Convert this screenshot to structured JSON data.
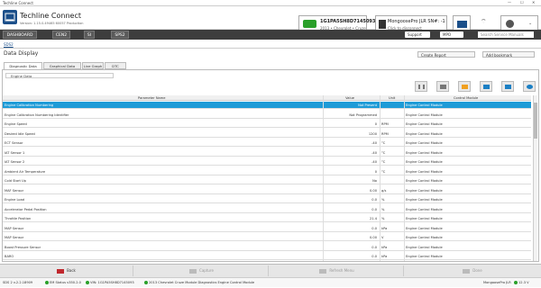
{
  "window": {
    "title": "Techline Connect",
    "controls": [
      "—",
      "☐",
      "✕"
    ]
  },
  "header": {
    "app_title": "Techline Connect",
    "version": "Version: 1.15.0.49465 60057 Production",
    "vin": "1G1PA5SH8D7145093",
    "vehicle": "2013 • Chevrolet • Cruze",
    "device": "MongoosePro JLR SN#: -1",
    "device_status": "Click to disconnect",
    "chevron": "⌄"
  },
  "nav": {
    "items": [
      "DASHBOARD",
      "CEN2",
      "SI",
      "SPS2"
    ],
    "support": "Support",
    "mpo": "MPO",
    "search_placeholder": "Search Service Manuals"
  },
  "breadcrumb": "SDS2",
  "page": {
    "title": "Data Display",
    "create_report": "Create Report",
    "add_bookmark": "Add bookmark"
  },
  "tabs": [
    "Diagnostic Data Display",
    "Graphical Data Display",
    "Live Graph",
    "DTC Display"
  ],
  "engine_data": "Engine Data",
  "grid": {
    "headers": [
      "Parameter Name",
      "Value",
      "Unit",
      "Control Module"
    ],
    "rows": [
      [
        "Engine Calibration Numbering",
        "Not Present",
        "",
        "Engine Control Module"
      ],
      [
        "Engine Calibration Numbering Identifier",
        "Not Programmed",
        "",
        "Engine Control Module"
      ],
      [
        "Engine Speed",
        "0",
        "RPM",
        "Engine Control Module"
      ],
      [
        "Desired Idle Speed",
        "1200",
        "RPM",
        "Engine Control Module"
      ],
      [
        "ECT Sensor",
        "-40",
        "°C",
        "Engine Control Module"
      ],
      [
        "IAT Sensor 1",
        "-40",
        "°C",
        "Engine Control Module"
      ],
      [
        "IAT Sensor 2",
        "-40",
        "°C",
        "Engine Control Module"
      ],
      [
        "Ambient Air Temperature",
        "0",
        "°C",
        "Engine Control Module"
      ],
      [
        "Cold Start Up",
        "No",
        "",
        "Engine Control Module"
      ],
      [
        "MAF Sensor",
        "0.00",
        "g/s",
        "Engine Control Module"
      ],
      [
        "Engine Load",
        "0.0",
        "%",
        "Engine Control Module"
      ],
      [
        "Accelerator Pedal Position",
        "0.0",
        "%",
        "Engine Control Module"
      ],
      [
        "Throttle Position",
        "21.4",
        "%",
        "Engine Control Module"
      ],
      [
        "MAP Sensor",
        "0.0",
        "kPa",
        "Engine Control Module"
      ],
      [
        "MAP Sensor",
        "0.00",
        "V",
        "Engine Control Module"
      ],
      [
        "Boost Pressure Sensor",
        "0.0",
        "kPa",
        "Engine Control Module"
      ],
      [
        "BARO",
        "0.0",
        "kPa",
        "Engine Control Module"
      ]
    ]
  },
  "bottom": {
    "back": "Back",
    "capture": "Capture",
    "refresh": "Refresh Menu",
    "done": "Done"
  },
  "status": {
    "sds": "SDS 2 v.2.2.18909",
    "ebm": "EM Status v350.2.0",
    "vin": "VIN: 1G1PA5SH8D7145093",
    "path": "2013 Chevrolet Cruze Module Diagnostics Engine Control Module",
    "device": "MongoosePro JLR",
    "voltage": "12.3 V"
  },
  "colors": {
    "selected": "#1e9bd7",
    "nav": "#3d3d3d",
    "brand": "#1b4f8a"
  }
}
